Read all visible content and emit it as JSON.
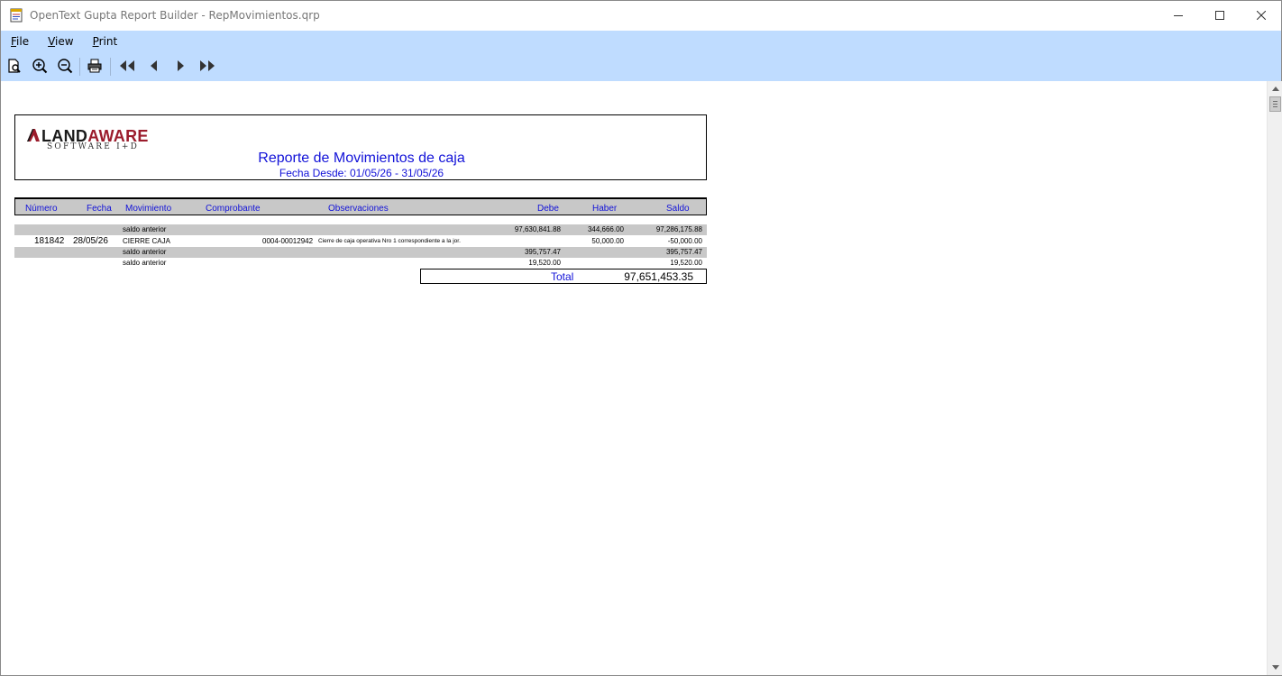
{
  "window": {
    "title": "OpenText Gupta Report Builder - RepMovimientos.qrp"
  },
  "menu": [
    {
      "label_u": "F",
      "label_rest": "ile"
    },
    {
      "label_u": "V",
      "label_rest": "iew"
    },
    {
      "label_u": "P",
      "label_rest": "rint"
    }
  ],
  "toolbar_icons": [
    "page-preview-icon",
    "zoom-in-icon",
    "zoom-out-icon",
    "printer-icon",
    "first-page-icon",
    "previous-page-icon",
    "next-page-icon",
    "last-page-icon"
  ],
  "report": {
    "logo": {
      "brand_a": "LAND",
      "brand_b": "AWARE",
      "sub": "SOFTWARE I+D"
    },
    "title": "Reporte de Movimientos de caja",
    "date_range": "Fecha Desde: 01/05/26 - 31/05/26",
    "columns": {
      "numero": "Número",
      "fecha": "Fecha",
      "movimiento": "Movimiento",
      "comprobante": "Comprobante",
      "observaciones": "Observaciones",
      "debe": "Debe",
      "haber": "Haber",
      "saldo": "Saldo"
    },
    "rows": [
      {
        "numero": "",
        "fecha": "",
        "movimiento": "saldo anterior",
        "comprobante": "",
        "observaciones": "",
        "debe": "97,630,841.88",
        "haber": "344,666.00",
        "saldo": "97,286,175.88"
      },
      {
        "numero": "181842",
        "fecha": "28/05/26",
        "movimiento": "CIERRE CAJA",
        "comprobante": "0004-00012942",
        "observaciones": "Cierre de caja operativa Nro 1 correspondiente a la jor.",
        "debe": "",
        "haber": "50,000.00",
        "saldo": "-50,000.00"
      },
      {
        "numero": "",
        "fecha": "",
        "movimiento": "saldo anterior",
        "comprobante": "",
        "observaciones": "",
        "debe": "395,757.47",
        "haber": "",
        "saldo": "395,757.47"
      },
      {
        "numero": "",
        "fecha": "",
        "movimiento": "saldo anterior",
        "comprobante": "",
        "observaciones": "",
        "debe": "19,520.00",
        "haber": "",
        "saldo": "19,520.00"
      }
    ],
    "total_label": "Total",
    "total_value": "97,651,453.35"
  },
  "colors": {
    "chrome_bg": "#bfdcff",
    "report_blue": "#1212d8",
    "row_grey": "#c8c8c8",
    "brand_red": "#9b1c2c"
  }
}
